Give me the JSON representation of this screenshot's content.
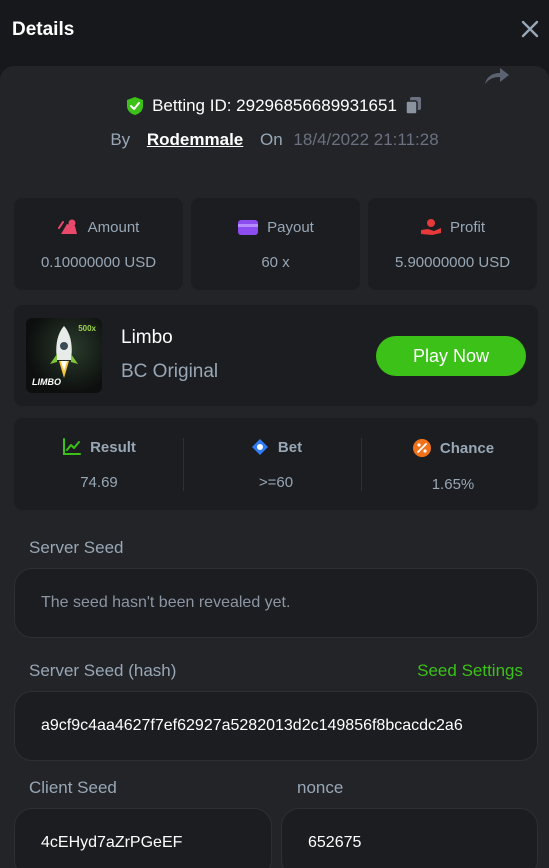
{
  "header": {
    "title": "Details"
  },
  "bet": {
    "id_label": "Betting ID: 29296856689931651",
    "by_label": "By",
    "user": "Rodemmale",
    "on_label": "On",
    "date": "18/4/2022 21:11:28"
  },
  "stats": [
    {
      "label": "Amount",
      "value": "0.10000000 USD",
      "icon": "amount-icon",
      "color": "#e94a6b"
    },
    {
      "label": "Payout",
      "value": "60 x",
      "icon": "wallet-icon",
      "color": "#8b4cf0"
    },
    {
      "label": "Profit",
      "value": "5.90000000 USD",
      "icon": "profit-icon",
      "color": "#e5393a"
    }
  ],
  "game": {
    "name": "Limbo",
    "provider": "BC Original",
    "thumb_label": "LIMBO",
    "thumb_multiplier": "500x",
    "play_label": "Play Now"
  },
  "result": [
    {
      "label": "Result",
      "value": "74.69",
      "icon": "result-icon",
      "color": "#3bc117"
    },
    {
      "label": "Bet",
      "value": ">=60",
      "icon": "bet-icon",
      "color": "#2f7cf6"
    },
    {
      "label": "Chance",
      "value": "1.65%",
      "icon": "percent-icon",
      "color": "#f0731c"
    }
  ],
  "server_seed": {
    "label": "Server Seed",
    "value": "The seed hasn't been revealed yet."
  },
  "server_seed_hash": {
    "label": "Server Seed (hash)",
    "link": "Seed Settings",
    "value": "a9cf9c4aa4627f7ef62927a5282013d2c149856f8bcacdc2a6"
  },
  "client_seed": {
    "label": "Client Seed",
    "value": "4cEHyd7aZrPGeEF"
  },
  "nonce": {
    "label": "nonce",
    "value": "652675"
  },
  "colors": {
    "accent": "#3bc117",
    "verified": "#3bc117"
  }
}
